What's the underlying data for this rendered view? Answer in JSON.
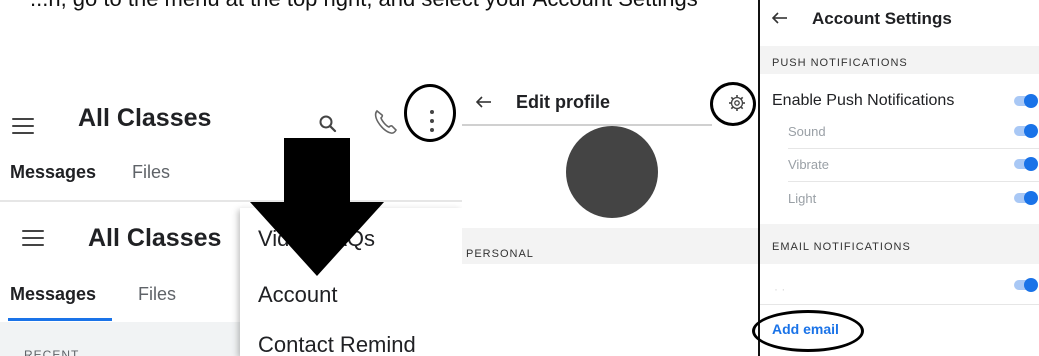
{
  "caption": {
    "text": "...n, go to the menu at the top right, and select your Account Settings"
  },
  "panel1": {
    "header": {
      "title": "All Classes",
      "tabs": [
        {
          "label": "Messages"
        },
        {
          "label": "Files"
        }
      ]
    },
    "lower": {
      "title": "All Classes",
      "tabs": [
        {
          "label": "Messages"
        },
        {
          "label": "Files"
        }
      ],
      "recent_label": "RECENT"
    },
    "overflow_menu": {
      "items": [
        {
          "label": "Video FAQs"
        },
        {
          "label": "Account"
        },
        {
          "label": "Contact Remind"
        }
      ]
    }
  },
  "panel2": {
    "title": "Edit profile",
    "section_label": "PERSONAL"
  },
  "panel3": {
    "title": "Account Settings",
    "push_section": "PUSH NOTIFICATIONS",
    "rows": [
      {
        "label": "Enable Push Notifications",
        "enabled": true
      },
      {
        "label": "Sound",
        "enabled": true
      },
      {
        "label": "Vibrate",
        "enabled": true
      },
      {
        "label": "Light",
        "enabled": true
      }
    ],
    "email_section": "EMAIL NOTIFICATIONS",
    "email_row_enabled": true,
    "add_email_label": "Add email"
  },
  "colors": {
    "accent": "#1a73e8",
    "toggle_track": "#a9c8f5",
    "avatar": "#444444"
  }
}
